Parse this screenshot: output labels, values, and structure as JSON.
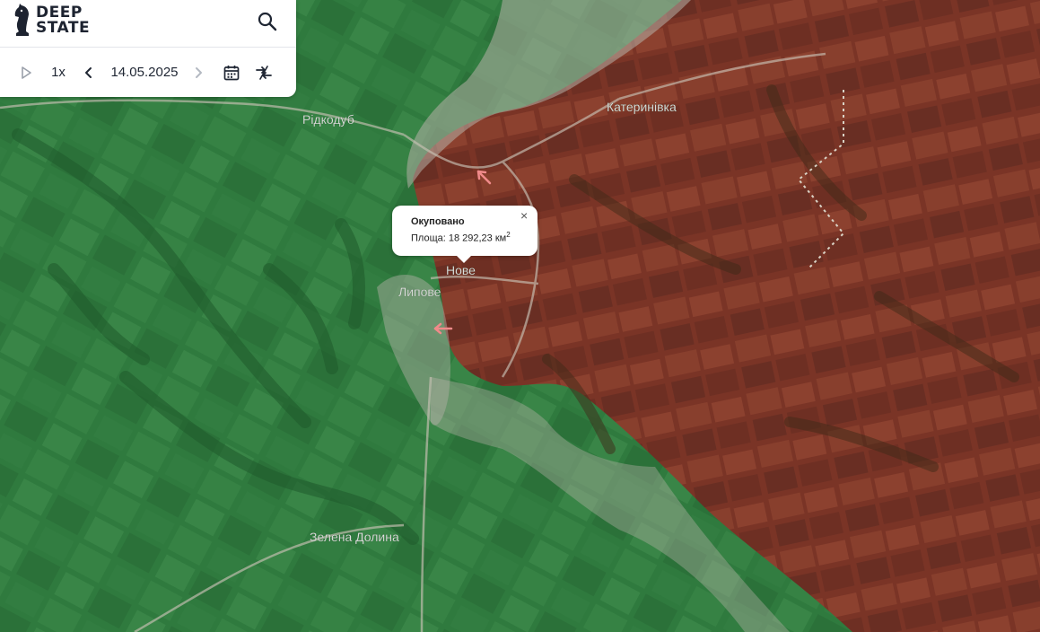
{
  "app": {
    "logo_line1": "DEEP",
    "logo_line2": "STATE"
  },
  "toolbar": {
    "speed": "1x",
    "date": "14.05.2025"
  },
  "map": {
    "place_labels": {
      "ridkodub": "Рідкодуб",
      "katerynivka": "Катеринівка",
      "nove": "Нове",
      "lypove": "Липове",
      "zelena_dolyna": "Зелена Долина"
    },
    "colors": {
      "controlled": "#2f7a3e",
      "occupied": "#7a3426",
      "gray_zone": "#b6b1a8",
      "arrow": "#f08a8a"
    }
  },
  "popup": {
    "title": "Окуповано",
    "area_label": "Площа: 18 292,23 км",
    "area_unit_sup": "2",
    "close_symbol": "×"
  },
  "icons": [
    "search-icon",
    "play-icon",
    "chevron-left-icon",
    "chevron-right-icon",
    "calendar-icon",
    "compare-icon",
    "close-icon",
    "knight-logo",
    "advance-arrow-icon"
  ]
}
